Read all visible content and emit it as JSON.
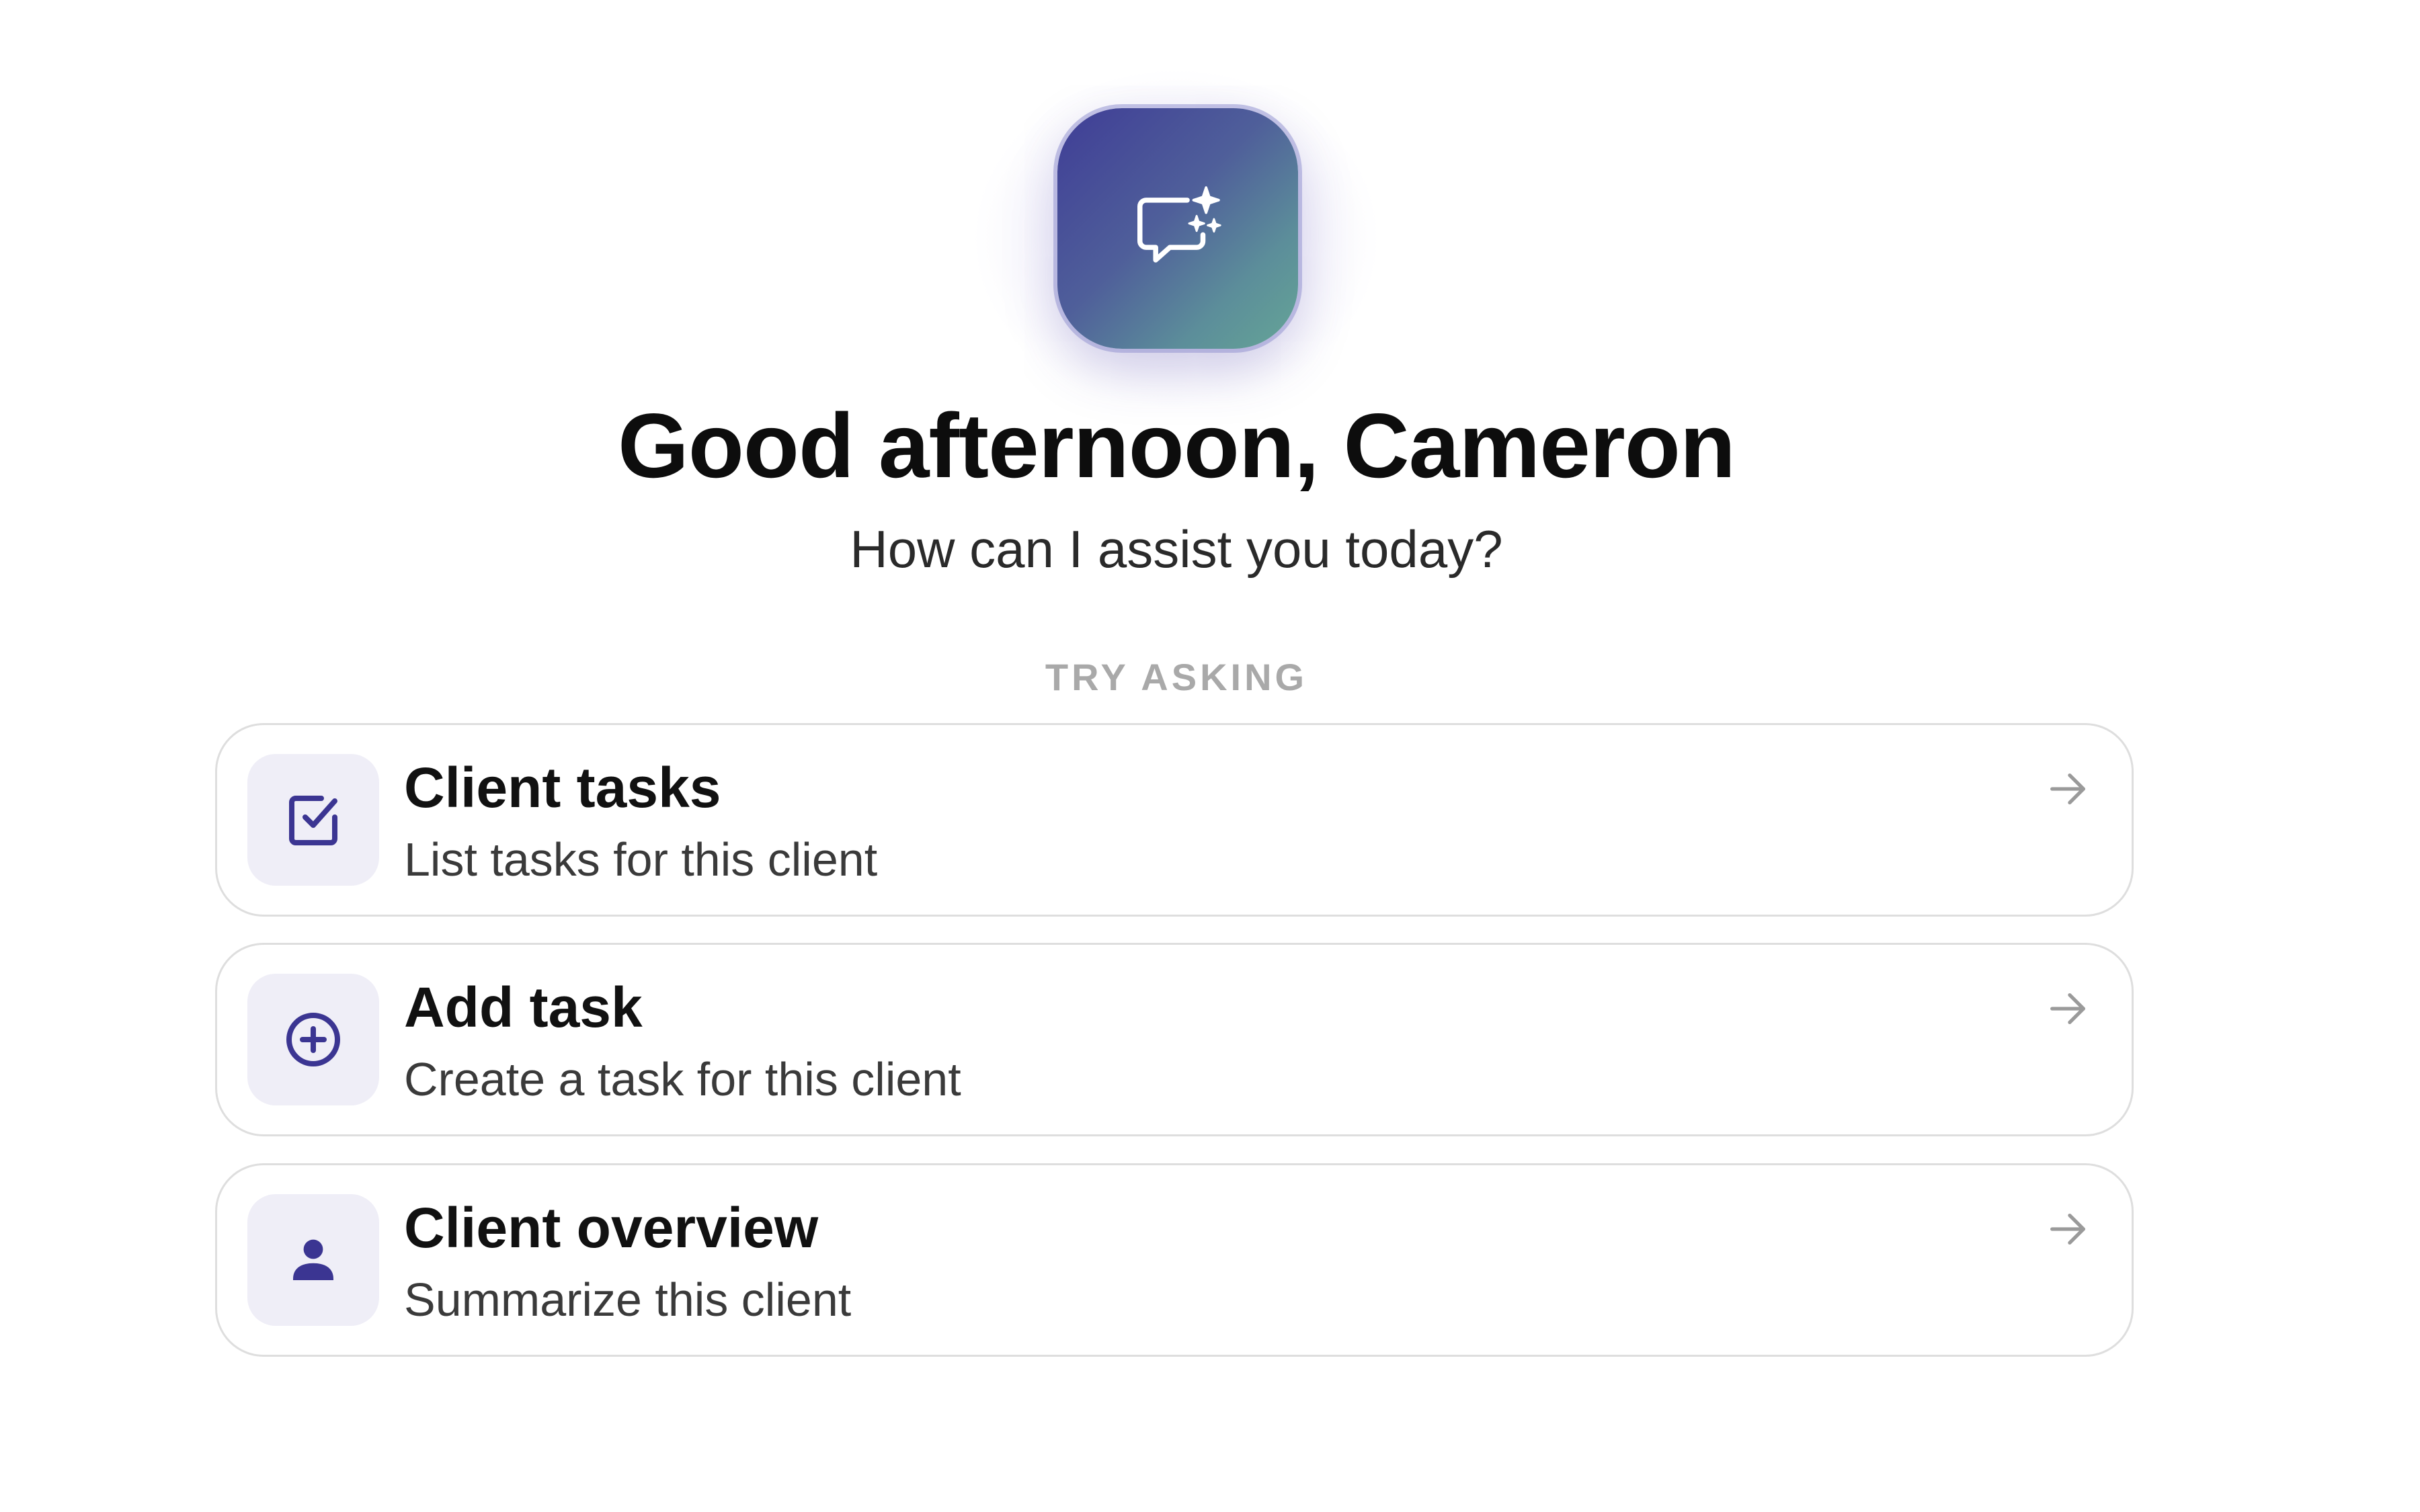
{
  "header": {
    "logo_icon": "chat-sparkle-icon",
    "greeting": "Good afternoon, Cameron",
    "subtitle": "How can I assist you today?"
  },
  "suggestions_label": "TRY ASKING",
  "suggestions": [
    {
      "icon": "checkbox-icon",
      "title": "Client tasks",
      "description": "List tasks for this client"
    },
    {
      "icon": "plus-circle-icon",
      "title": "Add task",
      "description": "Create a task for this client"
    },
    {
      "icon": "person-icon",
      "title": "Client overview",
      "description": "Summarize this client"
    }
  ],
  "colors": {
    "accent": "#3b3592",
    "logo_gradient_start": "#3f3d96",
    "logo_gradient_end": "#65a596",
    "icon_tile_bg": "#efeef7",
    "card_border": "#dedede",
    "muted_label": "#a9a9a9"
  }
}
